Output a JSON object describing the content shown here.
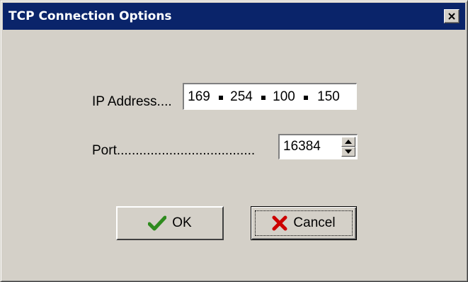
{
  "window": {
    "title": "TCP Connection Options",
    "close_icon": "close-x-icon",
    "title_bar_color": "#0a246a",
    "face_color": "#d4d0c8"
  },
  "form": {
    "ip_label": "IP Address....",
    "ip_octets": [
      "169",
      "254",
      "100",
      "150"
    ],
    "port_label": "Port.....................................",
    "port_value": "16384",
    "port_spinner_icons": [
      "spin-up-arrow-icon",
      "spin-down-arrow-icon"
    ]
  },
  "buttons": {
    "ok_label": "OK",
    "ok_icon": "checkmark-icon",
    "ok_icon_color": "#2e8b1e",
    "cancel_label": "Cancel",
    "cancel_icon": "red-x-icon",
    "cancel_icon_color": "#cc0000"
  }
}
